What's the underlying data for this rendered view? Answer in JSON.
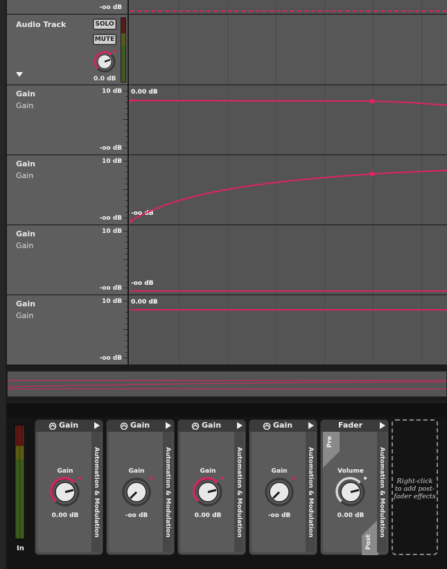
{
  "tracks": {
    "top_lane": {
      "scale_bottom": "-oo dB"
    },
    "audio_track": {
      "name": "Audio Track",
      "solo_label": "SOLO",
      "mute_label": "MUTE",
      "volume_value": "0.0 dB"
    },
    "automation_lanes": [
      {
        "title": "Gain",
        "subtitle": "Gain",
        "scale_top": "10 dB",
        "scale_bottom": "-oo dB",
        "value_label": "0.00 dB"
      },
      {
        "title": "Gain",
        "subtitle": "Gain",
        "scale_top": "10 dB",
        "scale_bottom": "-oo dB",
        "value_label": "-oo dB"
      },
      {
        "title": "Gain",
        "subtitle": "Gain",
        "scale_top": "10 dB",
        "scale_bottom": "-oo dB",
        "value_label": "-oo dB"
      },
      {
        "title": "Gain",
        "subtitle": "Gain",
        "scale_top": "10 dB",
        "scale_bottom": "-oo dB",
        "value_label": "0.00 dB"
      }
    ]
  },
  "devices": {
    "input_meter_label": "In",
    "chain": [
      {
        "title": "Gain",
        "param_label": "Gain",
        "param_value": "0.00 dB",
        "side_label": "Automation & Modulation",
        "knob_level": 1.0,
        "modulated": true
      },
      {
        "title": "Gain",
        "param_label": "Gain",
        "param_value": "-oo dB",
        "side_label": "Automation & Modulation",
        "knob_level": 0.0,
        "modulated": false
      },
      {
        "title": "Gain",
        "param_label": "Gain",
        "param_value": "0.00 dB",
        "side_label": "Automation & Modulation",
        "knob_level": 1.0,
        "modulated": true
      },
      {
        "title": "Gain",
        "param_label": "Gain",
        "param_value": "-oo dB",
        "side_label": "Automation & Modulation",
        "knob_level": 0.0,
        "modulated": false
      }
    ],
    "fader": {
      "title": "Fader",
      "pre_label": "Pre",
      "post_label": "Post",
      "param_label": "Volume",
      "param_value": "0.00 dB",
      "side_label": "Automation & Modulation"
    },
    "post_fader_hint": "Right-click to add post-fader effects"
  },
  "colors": {
    "automation": "#e0245e",
    "accent_knob": "#d0285e"
  }
}
